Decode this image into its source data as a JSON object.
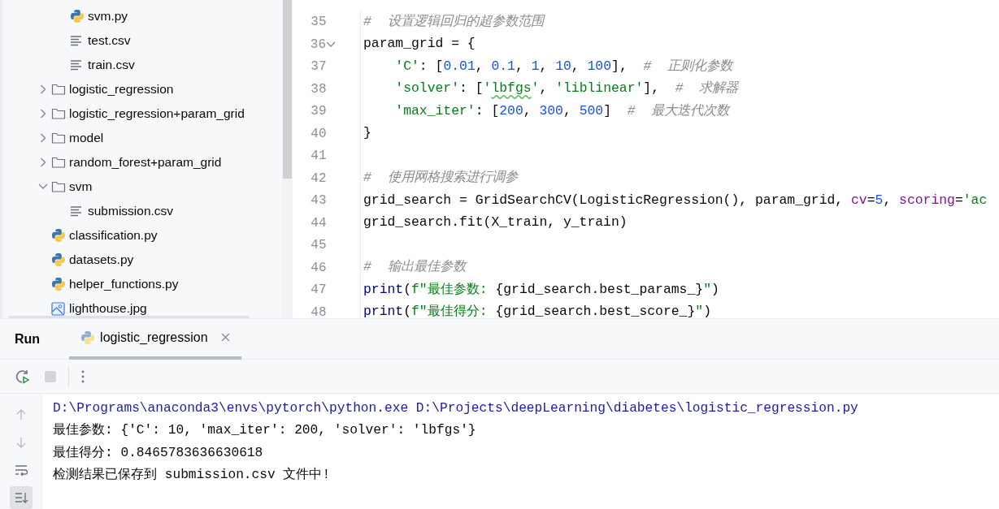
{
  "project_tree": {
    "items": [
      {
        "kind": "continuation",
        "children": [
          {
            "kind": "python",
            "label": "svm.py"
          },
          {
            "kind": "text",
            "label": "test.csv"
          },
          {
            "kind": "text",
            "label": "train.csv"
          }
        ]
      },
      {
        "kind": "folder",
        "label": "logistic_regression",
        "expanded": false
      },
      {
        "kind": "folder",
        "label": "logistic_regression+param_grid",
        "expanded": false
      },
      {
        "kind": "folder",
        "label": "model",
        "expanded": false
      },
      {
        "kind": "folder",
        "label": "random_forest+param_grid",
        "expanded": false
      },
      {
        "kind": "folder",
        "label": "svm",
        "expanded": true,
        "children": [
          {
            "kind": "text",
            "label": "submission.csv"
          }
        ]
      },
      {
        "kind": "python",
        "label": "classification.py"
      },
      {
        "kind": "python",
        "label": "datasets.py"
      },
      {
        "kind": "python",
        "label": "helper_functions.py"
      },
      {
        "kind": "image",
        "label": "lighthouse.jpg"
      }
    ]
  },
  "editor": {
    "lines": [
      {
        "number": "35",
        "tokens": [
          {
            "kind": "comment",
            "text": "#  设置逻辑回归的超参数范围"
          }
        ]
      },
      {
        "number": "36",
        "fold": true,
        "tokens": [
          {
            "kind": "plain",
            "text": "param_grid = {"
          }
        ]
      },
      {
        "number": "37",
        "indented": true,
        "tokens": [
          {
            "kind": "string",
            "text": "'C'"
          },
          {
            "kind": "plain",
            "text": ": ["
          },
          {
            "kind": "number",
            "text": "0.01"
          },
          {
            "kind": "plain",
            "text": ", "
          },
          {
            "kind": "number",
            "text": "0.1"
          },
          {
            "kind": "plain",
            "text": ", "
          },
          {
            "kind": "number",
            "text": "1"
          },
          {
            "kind": "plain",
            "text": ", "
          },
          {
            "kind": "number",
            "text": "10"
          },
          {
            "kind": "plain",
            "text": ", "
          },
          {
            "kind": "number",
            "text": "100"
          },
          {
            "kind": "plain",
            "text": "],  "
          },
          {
            "kind": "comment",
            "text": "#  正则化参数"
          }
        ]
      },
      {
        "number": "38",
        "indented": true,
        "tokens": [
          {
            "kind": "string",
            "text": "'solver'"
          },
          {
            "kind": "plain",
            "text": ": ["
          },
          {
            "kind": "string",
            "text": "'"
          },
          {
            "kind": "string",
            "text": "lbfgs",
            "spelling_warning": true
          },
          {
            "kind": "string",
            "text": "'"
          },
          {
            "kind": "plain",
            "text": ", "
          },
          {
            "kind": "string",
            "text": "'liblinear'"
          },
          {
            "kind": "plain",
            "text": "],  "
          },
          {
            "kind": "comment",
            "text": "#  求解器"
          }
        ]
      },
      {
        "number": "39",
        "indented": true,
        "tokens": [
          {
            "kind": "string",
            "text": "'max_iter'"
          },
          {
            "kind": "plain",
            "text": ": ["
          },
          {
            "kind": "number",
            "text": "200"
          },
          {
            "kind": "plain",
            "text": ", "
          },
          {
            "kind": "number",
            "text": "300"
          },
          {
            "kind": "plain",
            "text": ", "
          },
          {
            "kind": "number",
            "text": "500"
          },
          {
            "kind": "plain",
            "text": "]  "
          },
          {
            "kind": "comment",
            "text": "#  最大迭代次数"
          }
        ]
      },
      {
        "number": "40",
        "tokens": [
          {
            "kind": "plain",
            "text": "}"
          }
        ]
      },
      {
        "number": "41"
      },
      {
        "number": "42",
        "tokens": [
          {
            "kind": "comment",
            "text": "#  使用网格搜索进行调参"
          }
        ]
      },
      {
        "number": "43",
        "tokens": [
          {
            "kind": "plain",
            "text": "grid_search = GridSearchCV(LogisticRegression(), param_grid, "
          },
          {
            "kind": "param",
            "text": "cv"
          },
          {
            "kind": "plain",
            "text": "="
          },
          {
            "kind": "number",
            "text": "5"
          },
          {
            "kind": "plain",
            "text": ", "
          },
          {
            "kind": "param",
            "text": "scoring"
          },
          {
            "kind": "plain",
            "text": "="
          },
          {
            "kind": "string",
            "text": "'ac"
          }
        ]
      },
      {
        "number": "44",
        "tokens": [
          {
            "kind": "plain",
            "text": "grid_search.fit(X_train, y_train)"
          }
        ]
      },
      {
        "number": "45"
      },
      {
        "number": "46",
        "tokens": [
          {
            "kind": "comment",
            "text": "#  输出最佳参数"
          }
        ]
      },
      {
        "number": "47",
        "tokens": [
          {
            "kind": "builtin",
            "text": "print"
          },
          {
            "kind": "plain",
            "text": "("
          },
          {
            "kind": "string",
            "text": "f\"最佳参数: "
          },
          {
            "kind": "plain",
            "text": "{grid_search.best_params_}"
          },
          {
            "kind": "string",
            "text": "\""
          },
          {
            "kind": "plain",
            "text": ")"
          }
        ]
      },
      {
        "number": "48",
        "tokens": [
          {
            "kind": "builtin",
            "text": "print"
          },
          {
            "kind": "plain",
            "text": "("
          },
          {
            "kind": "string",
            "text": "f\"最佳得分: "
          },
          {
            "kind": "plain",
            "text": "{grid_search.best_score_}"
          },
          {
            "kind": "string",
            "text": "\""
          },
          {
            "kind": "plain",
            "text": ")"
          }
        ]
      }
    ]
  },
  "run_panel": {
    "title": "Run",
    "tabs": [
      {
        "label": "logistic_regression",
        "selected": true
      }
    ],
    "toolbar": {
      "stop_disabled": true
    },
    "side_tools": [
      {
        "kind": "up",
        "on": false
      },
      {
        "kind": "down",
        "on": false
      },
      {
        "kind": "wrap",
        "on": false
      },
      {
        "kind": "scroll-end",
        "on": true
      }
    ],
    "output": [
      {
        "kind": "command",
        "text": "D:\\Programs\\anaconda3\\envs\\pytorch\\python.exe D:\\Projects\\deepLearning\\diabetes\\logistic_regression.py"
      },
      {
        "kind": "stdout",
        "text": "最佳参数: {'C': 10, 'max_iter': 200, 'solver': 'lbfgs'}"
      },
      {
        "kind": "stdout",
        "text": "最佳得分: 0.8465783636630618"
      },
      {
        "kind": "stdout",
        "text": "检测结果已保存到 submission.csv 文件中!"
      }
    ]
  }
}
